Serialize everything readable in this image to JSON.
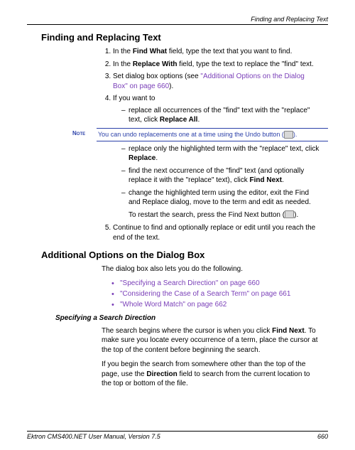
{
  "header": {
    "right": "Finding and Replacing Text"
  },
  "h1": "Finding and Replacing Text",
  "steps": {
    "s1a": "In the ",
    "s1b": "Find What",
    "s1c": " field, type the text that you want to find.",
    "s2a": "In the ",
    "s2b": "Replace With",
    "s2c": " field, type the text to replace the \"find\" text.",
    "s3a": "Set dialog box options (see ",
    "s3link": "\"Additional Options on the Dialog Box\" on page 660",
    "s3b": ").",
    "s4": "If you want to",
    "s4_sub1a": "replace all occurrences of the \"find\" text with the \"replace\" text, click ",
    "s4_sub1b": "Replace All",
    "s4_sub1c": ".",
    "s4_sub2a": "replace only the highlighted term with the \"replace\" text, click ",
    "s4_sub2b": "Replace",
    "s4_sub2c": ".",
    "s4_sub3a": "find the next occurrence of the \"find\" text (and optionally replace it with the \"replace\" text), click ",
    "s4_sub3b": "Find Next",
    "s4_sub3c": ".",
    "s4_sub4": "change the highlighted term using the editor, exit the Find and Replace dialog, move to the term and edit as needed.",
    "restart_a": "To restart the search, press the Find Next button (",
    "restart_b": ").",
    "s5": "Continue to find and optionally replace or edit until you reach the end of the text."
  },
  "note": {
    "label": "Note",
    "text_a": "You can undo replacements one at a time using the Undo button (",
    "text_b": ")."
  },
  "h2": "Additional Options on the Dialog Box",
  "intro2": "The dialog box also lets you do the following.",
  "bullets": {
    "b1": "\"Specifying a Search Direction\" on page 660",
    "b2": "\"Considering the Case of a Search Term\" on page 661",
    "b3": "\"Whole Word Match\" on page 662"
  },
  "h3": "Specifying a Search Direction",
  "para1a": "The search begins where the cursor is when you click ",
  "para1b": "Find Next",
  "para1c": ". To make sure you locate every occurrence of a term, place the cursor at the top of the content before beginning the search.",
  "para2a": "If you begin the search from somewhere other than the top of the page, use the ",
  "para2b": "Direction",
  "para2c": " field to search from the current location to the top or bottom of the file.",
  "footer": {
    "left": "Ektron CMS400.NET User Manual, Version 7.5",
    "right": "660"
  }
}
